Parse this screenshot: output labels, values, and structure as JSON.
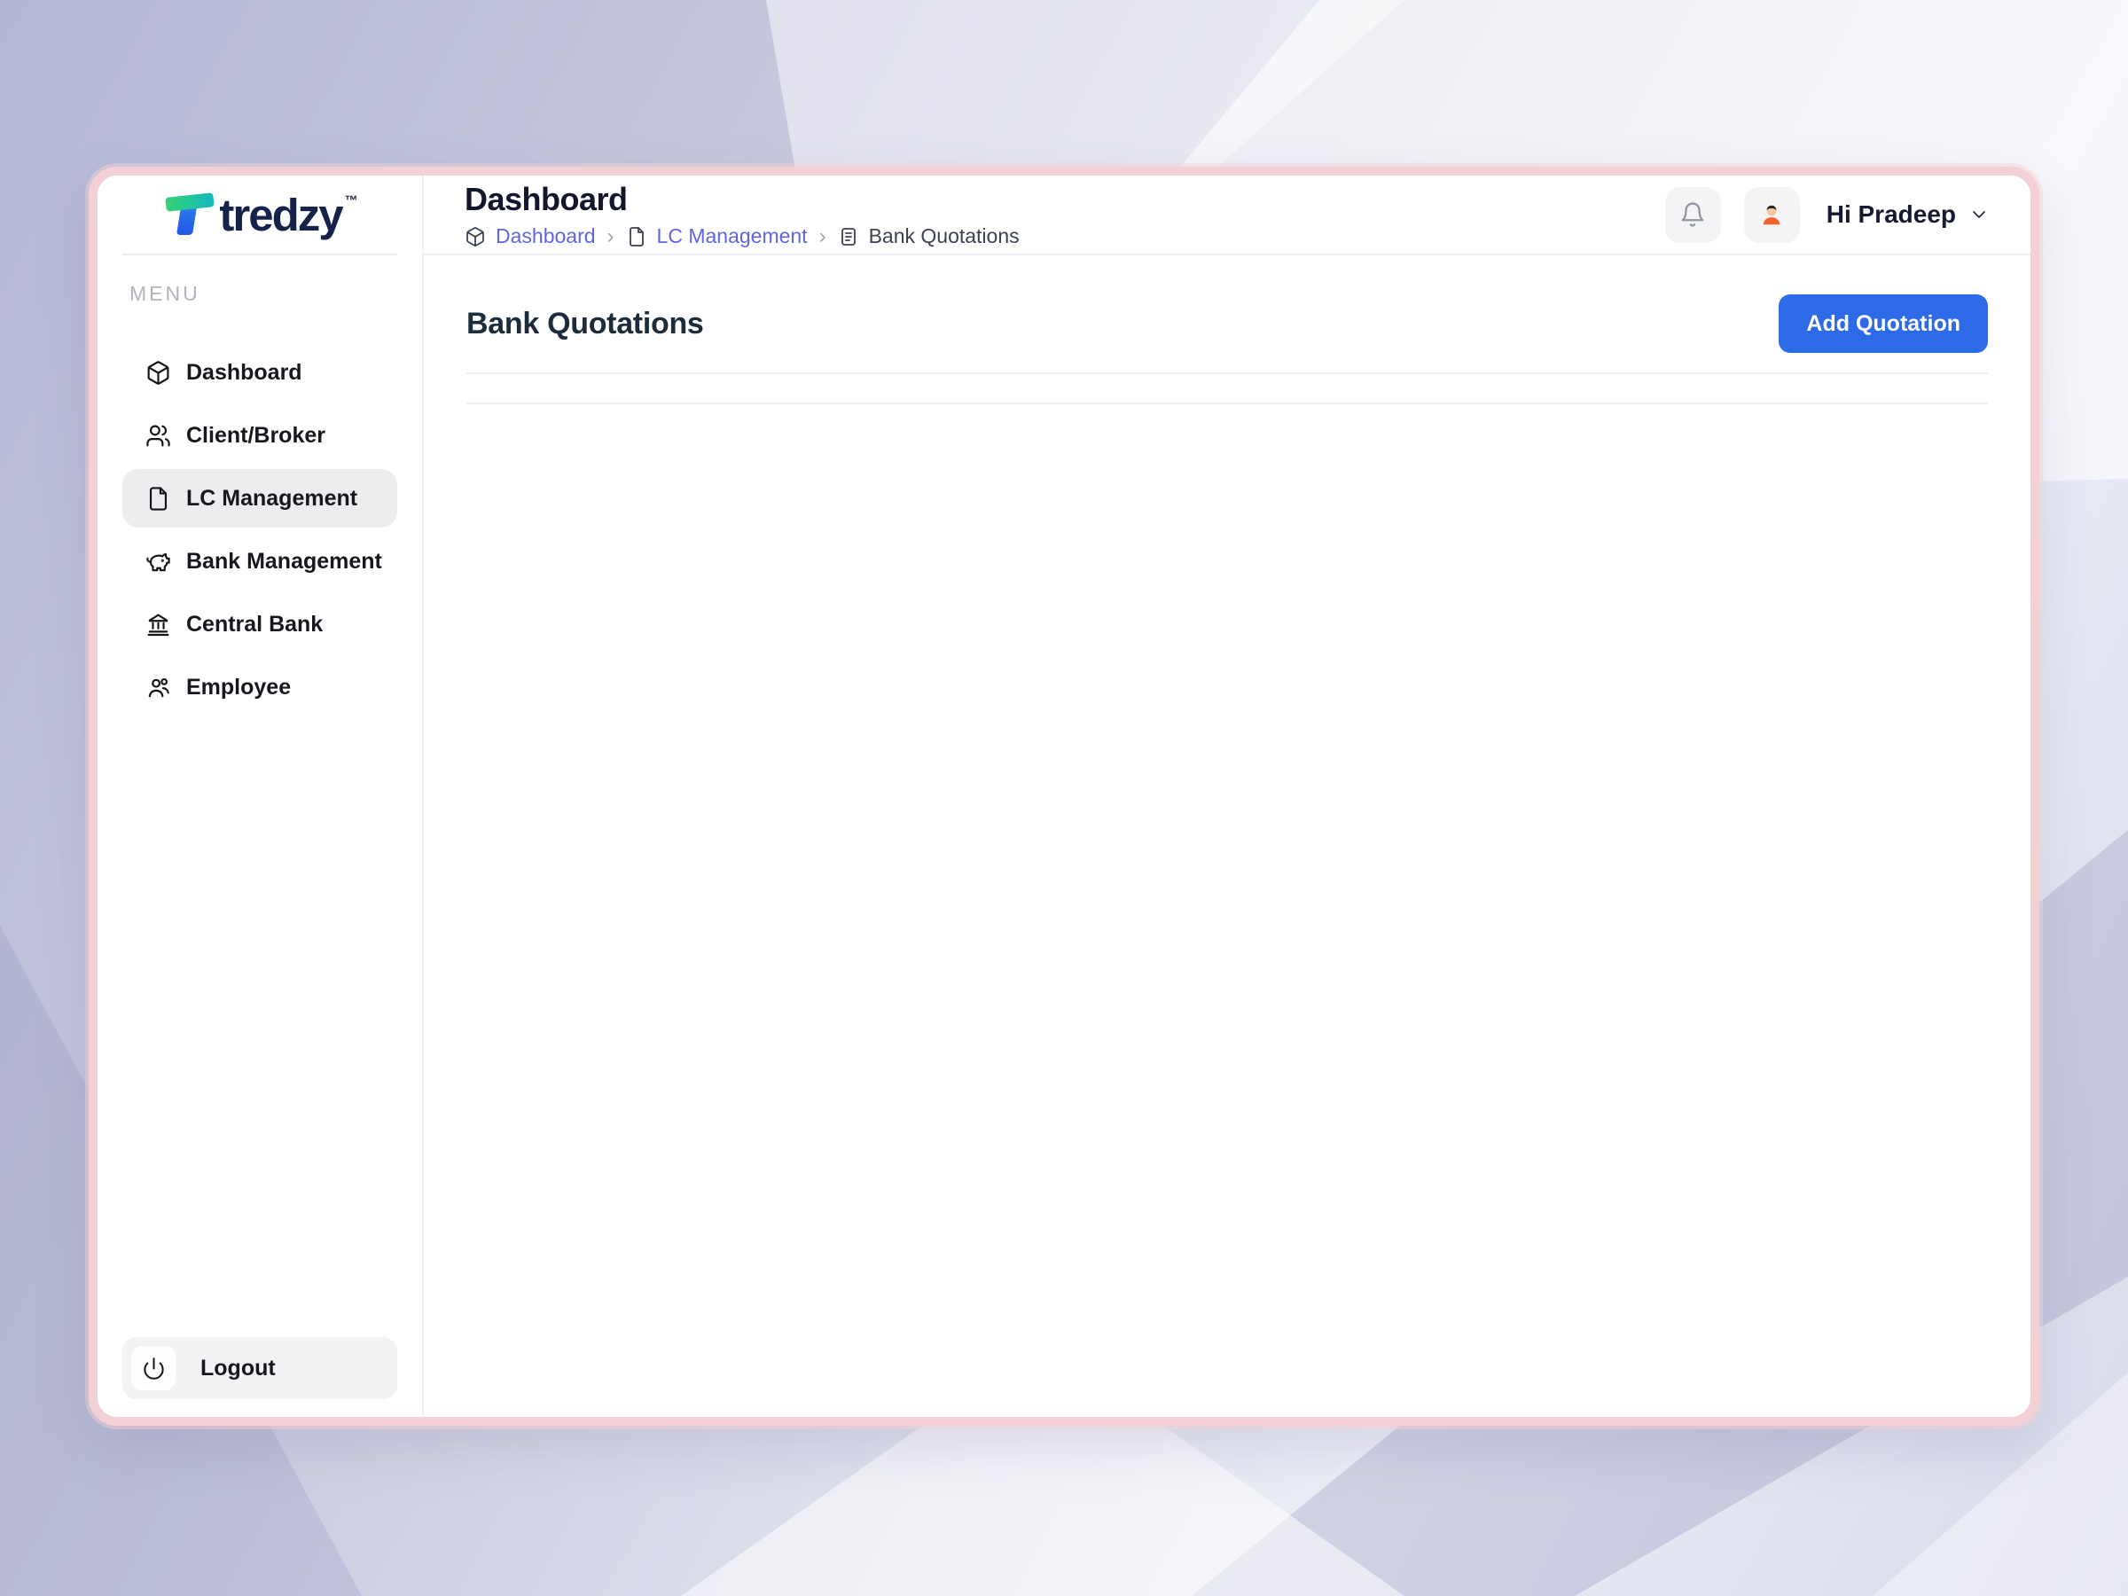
{
  "app": {
    "name": "tredzy",
    "trademark": "™"
  },
  "sidebar": {
    "section_label": "MENU",
    "items": [
      {
        "label": "Dashboard",
        "icon": "cube-icon",
        "active": false
      },
      {
        "label": "Client/Broker",
        "icon": "users-icon",
        "active": false
      },
      {
        "label": "LC Management",
        "icon": "file-icon",
        "active": true
      },
      {
        "label": "Bank Management",
        "icon": "piggy-bank-icon",
        "active": false
      },
      {
        "label": "Central Bank",
        "icon": "bank-icon",
        "active": false
      },
      {
        "label": "Employee",
        "icon": "users-icon",
        "active": false
      }
    ],
    "logout_label": "Logout"
  },
  "header": {
    "title": "Dashboard",
    "breadcrumb": [
      {
        "label": "Dashboard",
        "icon": "cube-icon",
        "type": "link"
      },
      {
        "label": "LC Management",
        "icon": "file-icon",
        "type": "link"
      },
      {
        "label": "Bank Quotations",
        "icon": "document-icon",
        "type": "current"
      }
    ],
    "breadcrumb_separator": "›",
    "greeting": "Hi Pradeep"
  },
  "main": {
    "heading": "Bank Quotations",
    "add_button_label": "Add Quotation"
  },
  "colors": {
    "accent_blue": "#2d6ae8",
    "breadcrumb_link": "#6065e0",
    "card_border_pink": "#f3d0d6",
    "logo_navy": "#15224a",
    "logo_green": "#35d077",
    "logo_blue": "#2f80f2",
    "active_item_bg": "#ededef",
    "background_lavender": "#c6c8dd"
  }
}
